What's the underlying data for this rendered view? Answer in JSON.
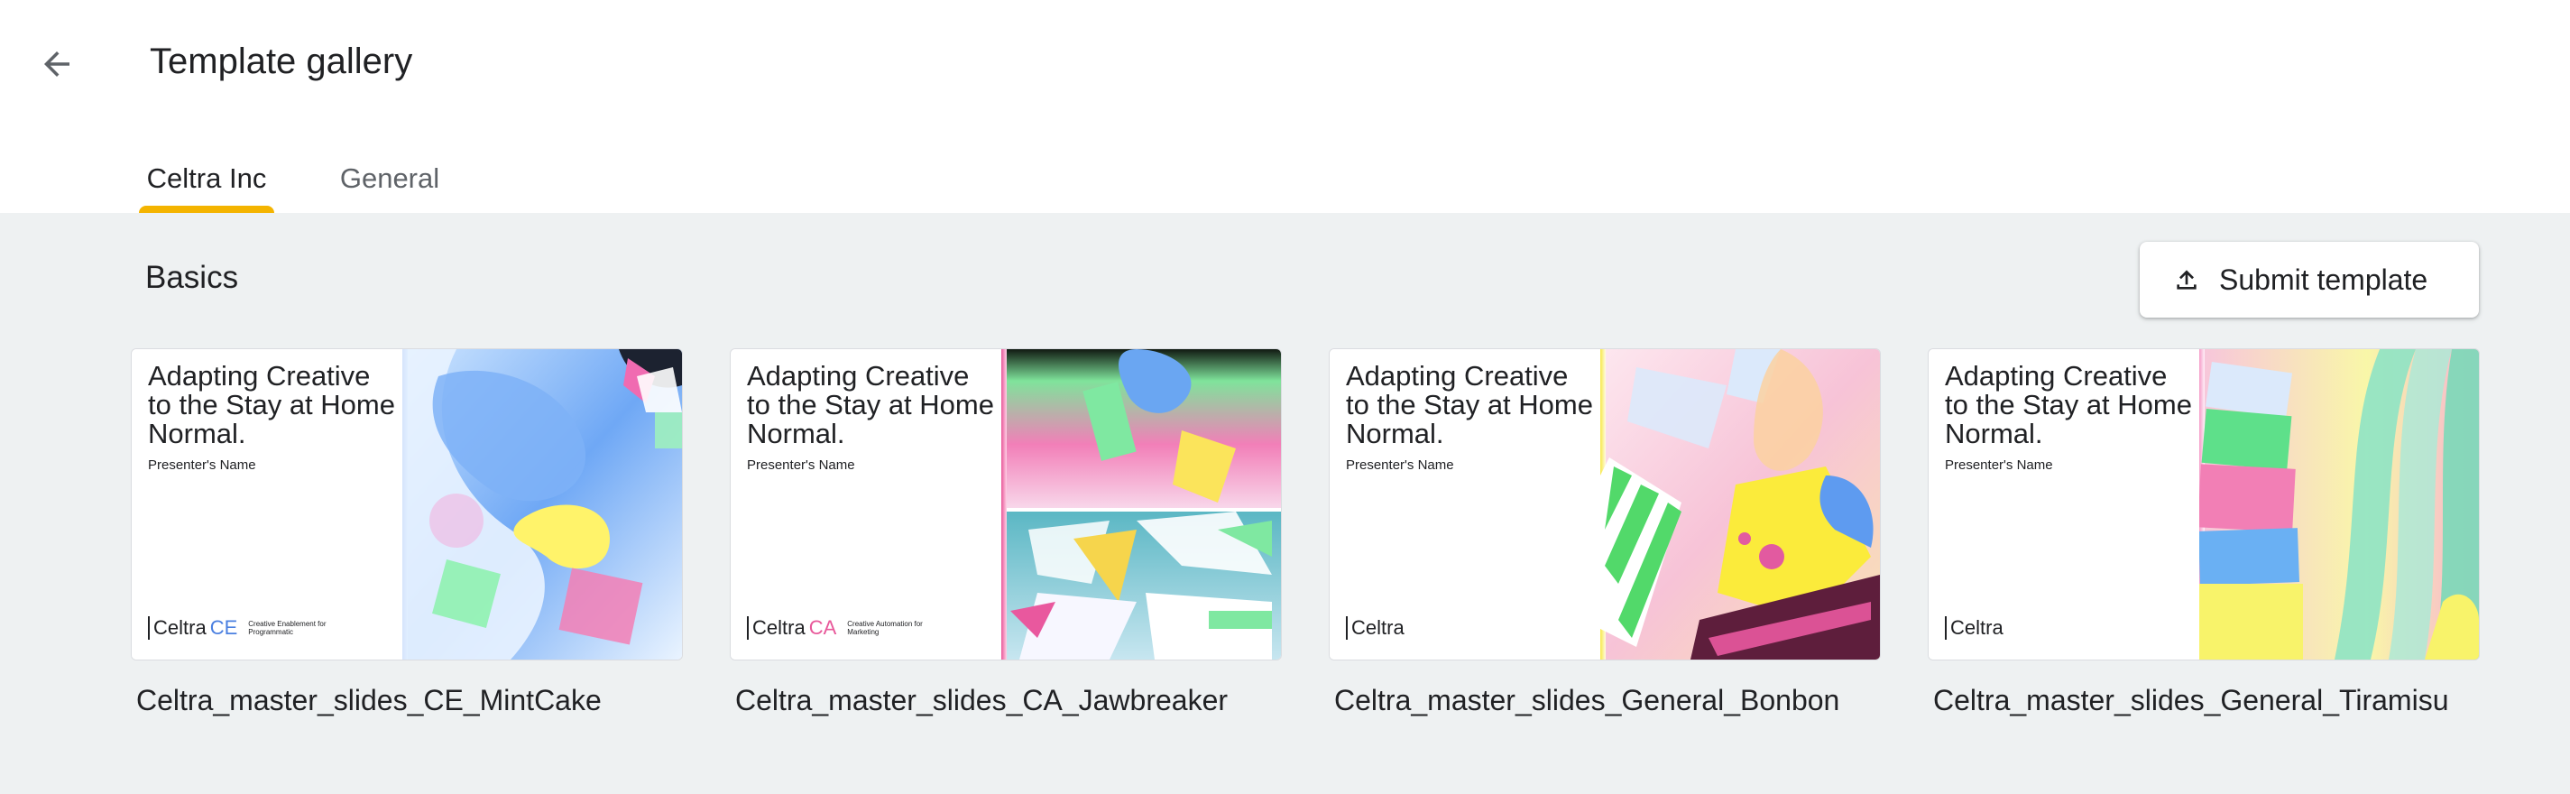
{
  "header": {
    "title": "Template gallery",
    "back_icon": "arrow-back-icon"
  },
  "tabs": [
    {
      "label": "Celtra Inc",
      "active": true
    },
    {
      "label": "General",
      "active": false
    }
  ],
  "colors": {
    "tab_indicator": "#f4b400",
    "content_background": "#eef1f2",
    "card_border": "#dadce0"
  },
  "section": {
    "title": "Basics",
    "submit_button": {
      "label": "Submit template",
      "icon": "upload-icon"
    }
  },
  "templates": [
    {
      "name": "Celtra_master_slides_CE_MintCake",
      "thumbnail": {
        "headline": "Adapting Creative to the Stay at Home Normal.",
        "presenter": "Presenter's Name",
        "logo_word": "Celtra",
        "logo_suffix": "CE",
        "logo_suffix_color": "#4a7fe0",
        "tagline": "Creative Enablement for Programmatic"
      }
    },
    {
      "name": "Celtra_master_slides_CA_Jawbreaker",
      "thumbnail": {
        "headline": "Adapting Creative to the Stay at Home Normal.",
        "presenter": "Presenter's Name",
        "logo_word": "Celtra",
        "logo_suffix": "CA",
        "logo_suffix_color": "#e8589a",
        "tagline": "Creative Automation for Marketing"
      }
    },
    {
      "name": "Celtra_master_slides_General_Bonbon",
      "thumbnail": {
        "headline": "Adapting Creative to the Stay at Home Normal.",
        "presenter": "Presenter's Name",
        "logo_word": "Celtra",
        "logo_suffix": "",
        "logo_suffix_color": "#202124",
        "tagline": ""
      }
    },
    {
      "name": "Celtra_master_slides_General_Tiramisu",
      "thumbnail": {
        "headline": "Adapting Creative to the Stay at Home Normal.",
        "presenter": "Presenter's Name",
        "logo_word": "Celtra",
        "logo_suffix": "",
        "logo_suffix_color": "#202124",
        "tagline": ""
      }
    }
  ]
}
